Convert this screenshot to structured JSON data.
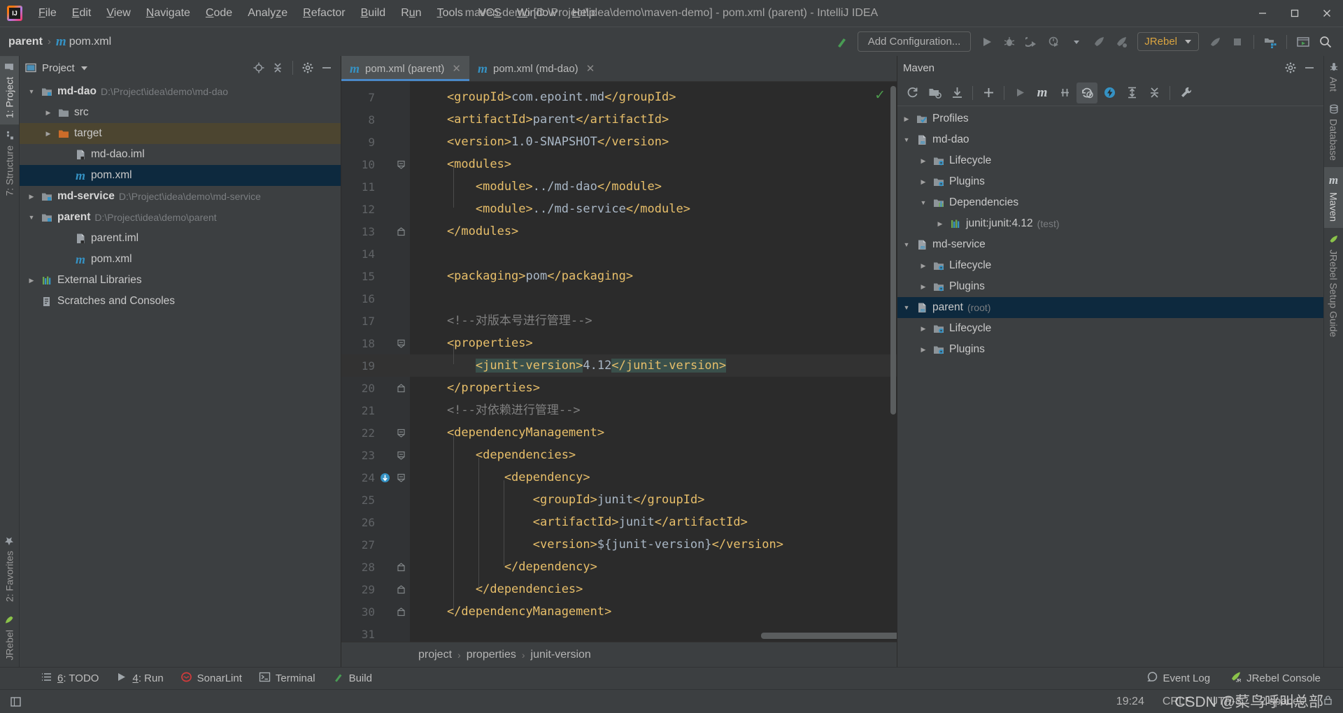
{
  "window": {
    "title": "maven-demo [D:\\Project\\idea\\demo\\maven-demo] - pom.xml (parent) - IntelliJ IDEA",
    "minimize": "─",
    "maximize": "☐",
    "close": "✕",
    "logo_text": "IJ"
  },
  "menubar": {
    "items": [
      {
        "label": "File",
        "mnemonic": "F"
      },
      {
        "label": "Edit",
        "mnemonic": "E"
      },
      {
        "label": "View",
        "mnemonic": "V"
      },
      {
        "label": "Navigate",
        "mnemonic": "N"
      },
      {
        "label": "Code",
        "mnemonic": "C"
      },
      {
        "label": "Analyze",
        "mnemonic": "z"
      },
      {
        "label": "Refactor",
        "mnemonic": "R"
      },
      {
        "label": "Build",
        "mnemonic": "B"
      },
      {
        "label": "Run",
        "mnemonic": "u"
      },
      {
        "label": "Tools",
        "mnemonic": "T"
      },
      {
        "label": "VCS",
        "mnemonic": "S"
      },
      {
        "label": "Window",
        "mnemonic": "W"
      },
      {
        "label": "Help",
        "mnemonic": "H"
      }
    ]
  },
  "navbar": {
    "crumbs": [
      "parent",
      "pom.xml"
    ],
    "separator": "›"
  },
  "toolbar": {
    "add_configuration_label": "Add Configuration...",
    "jrebel_label": "JRebel",
    "icons": [
      "build-hammer-icon",
      "run-icon",
      "debug-icon",
      "run-with-coverage-icon",
      "profiler-icon",
      "chevron-down-icon",
      "jrebel-run-icon",
      "jrebel-debug-icon",
      "jrebel-stop-icon",
      "stop-icon",
      "project-structure-icon",
      "update-running-app-icon",
      "search-everywhere-icon"
    ]
  },
  "left_stripe": {
    "top": [
      {
        "label": "1: Project",
        "icon": "folder-icon",
        "active": true
      },
      {
        "label": "7: Structure",
        "icon": "structure-icon",
        "active": false
      }
    ],
    "bottom": [
      {
        "label": "2: Favorites",
        "icon": "star-icon",
        "active": false
      },
      {
        "label": "JRebel",
        "icon": "jrebel-rocket-icon",
        "active": false
      }
    ]
  },
  "right_stripe": {
    "top": [
      {
        "label": "Ant",
        "icon": "ant-icon",
        "active": false
      },
      {
        "label": "Database",
        "icon": "database-icon",
        "active": false
      },
      {
        "label": "Maven",
        "icon": "maven-m-icon",
        "active": true
      }
    ],
    "bottom": [
      {
        "label": "JRebel Setup Guide",
        "icon": "jrebel-rocket-icon",
        "active": false
      }
    ]
  },
  "project_panel": {
    "title": "Project",
    "header_icons": [
      "locate-icon",
      "collapse-all-icon",
      "gear-icon",
      "hide-icon"
    ],
    "tree": [
      {
        "depth": 0,
        "arrow": "down",
        "icon": "module-folder-icon",
        "label": "md-dao",
        "bold": true,
        "path": "D:\\Project\\idea\\demo\\md-dao",
        "state": "normal"
      },
      {
        "depth": 1,
        "arrow": "right",
        "icon": "folder-icon",
        "label": "src",
        "bold": false,
        "path": "",
        "state": "normal"
      },
      {
        "depth": 1,
        "arrow": "right",
        "icon": "folder-orange-icon",
        "label": "target",
        "bold": false,
        "path": "",
        "state": "highlight"
      },
      {
        "depth": 2,
        "arrow": "none",
        "icon": "iml-file-icon",
        "label": "md-dao.iml",
        "bold": false,
        "path": "",
        "state": "normal"
      },
      {
        "depth": 2,
        "arrow": "none",
        "icon": "maven-m-icon",
        "label": "pom.xml",
        "bold": false,
        "path": "",
        "state": "selected"
      },
      {
        "depth": 0,
        "arrow": "right",
        "icon": "module-folder-icon",
        "label": "md-service",
        "bold": true,
        "path": "D:\\Project\\idea\\demo\\md-service",
        "state": "normal"
      },
      {
        "depth": 0,
        "arrow": "down",
        "icon": "module-folder-icon",
        "label": "parent",
        "bold": true,
        "path": "D:\\Project\\idea\\demo\\parent",
        "state": "normal"
      },
      {
        "depth": 2,
        "arrow": "none",
        "icon": "iml-file-icon",
        "label": "parent.iml",
        "bold": false,
        "path": "",
        "state": "normal"
      },
      {
        "depth": 2,
        "arrow": "none",
        "icon": "maven-m-icon",
        "label": "pom.xml",
        "bold": false,
        "path": "",
        "state": "normal"
      },
      {
        "depth": 0,
        "arrow": "right",
        "icon": "library-icon",
        "label": "External Libraries",
        "bold": false,
        "path": "",
        "state": "normal"
      },
      {
        "depth": 0,
        "arrow": "none",
        "icon": "scratches-icon",
        "label": "Scratches and Consoles",
        "bold": false,
        "path": "",
        "state": "normal"
      }
    ]
  },
  "editor": {
    "tabs": [
      {
        "label": "pom.xml (parent)",
        "icon": "maven-m-icon",
        "active": true
      },
      {
        "label": "pom.xml (md-dao)",
        "icon": "maven-m-icon",
        "active": false
      }
    ],
    "close_glyph": "✕",
    "inspection_ok_glyph": "✓",
    "first_line_number": 7,
    "lines": [
      {
        "n": 7,
        "fold": "none",
        "gutter_icon": "",
        "hl": false,
        "parts": [
          {
            "t": "tag",
            "s": "    <groupId>"
          },
          {
            "t": "txt",
            "s": "com.epoint.md"
          },
          {
            "t": "tag",
            "s": "</groupId>"
          }
        ]
      },
      {
        "n": 8,
        "fold": "none",
        "gutter_icon": "",
        "hl": false,
        "parts": [
          {
            "t": "tag",
            "s": "    <artifactId>"
          },
          {
            "t": "txt",
            "s": "parent"
          },
          {
            "t": "tag",
            "s": "</artifactId>"
          }
        ]
      },
      {
        "n": 9,
        "fold": "none",
        "gutter_icon": "",
        "hl": false,
        "parts": [
          {
            "t": "tag",
            "s": "    <version>"
          },
          {
            "t": "txt",
            "s": "1.0-SNAPSHOT"
          },
          {
            "t": "tag",
            "s": "</version>"
          }
        ]
      },
      {
        "n": 10,
        "fold": "open",
        "gutter_icon": "",
        "hl": false,
        "parts": [
          {
            "t": "tag",
            "s": "    <modules>"
          }
        ]
      },
      {
        "n": 11,
        "fold": "none",
        "gutter_icon": "",
        "hl": false,
        "parts": [
          {
            "t": "tag",
            "s": "        <module>"
          },
          {
            "t": "txt",
            "s": "../md-dao"
          },
          {
            "t": "tag",
            "s": "</module>"
          }
        ]
      },
      {
        "n": 12,
        "fold": "none",
        "gutter_icon": "",
        "hl": false,
        "parts": [
          {
            "t": "tag",
            "s": "        <module>"
          },
          {
            "t": "txt",
            "s": "../md-service"
          },
          {
            "t": "tag",
            "s": "</module>"
          }
        ]
      },
      {
        "n": 13,
        "fold": "close",
        "gutter_icon": "",
        "hl": false,
        "parts": [
          {
            "t": "tag",
            "s": "    </modules>"
          }
        ]
      },
      {
        "n": 14,
        "fold": "none",
        "gutter_icon": "",
        "hl": false,
        "parts": []
      },
      {
        "n": 15,
        "fold": "none",
        "gutter_icon": "",
        "hl": false,
        "parts": [
          {
            "t": "tag",
            "s": "    <packaging>"
          },
          {
            "t": "txt",
            "s": "pom"
          },
          {
            "t": "tag",
            "s": "</packaging>"
          }
        ]
      },
      {
        "n": 16,
        "fold": "none",
        "gutter_icon": "",
        "hl": false,
        "parts": []
      },
      {
        "n": 17,
        "fold": "none",
        "gutter_icon": "",
        "hl": false,
        "parts": [
          {
            "t": "cmt",
            "s": "    <!--对版本号进行管理-->"
          }
        ]
      },
      {
        "n": 18,
        "fold": "open",
        "gutter_icon": "",
        "hl": false,
        "parts": [
          {
            "t": "tag",
            "s": "    <properties>"
          }
        ]
      },
      {
        "n": 19,
        "fold": "none",
        "gutter_icon": "",
        "hl": true,
        "parts": [
          {
            "t": "txt",
            "s": "        "
          },
          {
            "t": "tag hlident",
            "s": "<junit-version>"
          },
          {
            "t": "txt",
            "s": "4.12"
          },
          {
            "t": "tag hlident",
            "s": "</junit-version>"
          }
        ]
      },
      {
        "n": 20,
        "fold": "close",
        "gutter_icon": "",
        "hl": false,
        "parts": [
          {
            "t": "tag",
            "s": "    </properties>"
          }
        ]
      },
      {
        "n": 21,
        "fold": "none",
        "gutter_icon": "",
        "hl": false,
        "parts": [
          {
            "t": "cmt",
            "s": "    <!--对依赖进行管理-->"
          }
        ]
      },
      {
        "n": 22,
        "fold": "open",
        "gutter_icon": "",
        "hl": false,
        "parts": [
          {
            "t": "tag",
            "s": "    <dependencyManagement>"
          }
        ]
      },
      {
        "n": 23,
        "fold": "open",
        "gutter_icon": "",
        "hl": false,
        "parts": [
          {
            "t": "tag",
            "s": "        <dependencies>"
          }
        ]
      },
      {
        "n": 24,
        "fold": "open",
        "gutter_icon": "download-dependency-icon",
        "hl": false,
        "parts": [
          {
            "t": "tag",
            "s": "            <dependency>"
          }
        ]
      },
      {
        "n": 25,
        "fold": "none",
        "gutter_icon": "",
        "hl": false,
        "parts": [
          {
            "t": "tag",
            "s": "                <groupId>"
          },
          {
            "t": "txt",
            "s": "junit"
          },
          {
            "t": "tag",
            "s": "</groupId>"
          }
        ]
      },
      {
        "n": 26,
        "fold": "none",
        "gutter_icon": "",
        "hl": false,
        "parts": [
          {
            "t": "tag",
            "s": "                <artifactId>"
          },
          {
            "t": "txt",
            "s": "junit"
          },
          {
            "t": "tag",
            "s": "</artifactId>"
          }
        ]
      },
      {
        "n": 27,
        "fold": "none",
        "gutter_icon": "",
        "hl": false,
        "parts": [
          {
            "t": "tag",
            "s": "                <version>"
          },
          {
            "t": "txt",
            "s": "${junit-version}"
          },
          {
            "t": "tag",
            "s": "</version>"
          }
        ]
      },
      {
        "n": 28,
        "fold": "close",
        "gutter_icon": "",
        "hl": false,
        "parts": [
          {
            "t": "tag",
            "s": "            </dependency>"
          }
        ]
      },
      {
        "n": 29,
        "fold": "close",
        "gutter_icon": "",
        "hl": false,
        "parts": [
          {
            "t": "tag",
            "s": "        </dependencies>"
          }
        ]
      },
      {
        "n": 30,
        "fold": "close",
        "gutter_icon": "",
        "hl": false,
        "parts": [
          {
            "t": "tag",
            "s": "    </dependencyManagement>"
          }
        ]
      },
      {
        "n": 31,
        "fold": "none",
        "gutter_icon": "",
        "hl": false,
        "parts": []
      }
    ],
    "breadcrumb": [
      "project",
      "properties",
      "junit-version"
    ],
    "breadcrumb_separator": "›"
  },
  "maven_panel": {
    "title": "Maven",
    "header_icons": [
      "gear-icon",
      "hide-icon"
    ],
    "toolbar_icons": [
      "reimport-icon",
      "generate-sources-icon",
      "download-sources-icon",
      "add-maven-project-icon",
      "run-icon",
      "execute-maven-goal-icon",
      "toggle-skip-tests-icon",
      "toggle-offline-icon",
      "toggle-auto-import-icon",
      "expand-all-icon",
      "collapse-all-icon",
      "maven-settings-icon"
    ],
    "tree": [
      {
        "depth": 0,
        "arrow": "right",
        "icon": "profiles-icon",
        "label": "Profiles",
        "suffix": "",
        "state": "normal"
      },
      {
        "depth": 0,
        "arrow": "down",
        "icon": "maven-proj-icon",
        "label": "md-dao",
        "suffix": "",
        "state": "normal"
      },
      {
        "depth": 1,
        "arrow": "right",
        "icon": "phase-icon",
        "label": "Lifecycle",
        "suffix": "",
        "state": "normal"
      },
      {
        "depth": 1,
        "arrow": "right",
        "icon": "phase-icon",
        "label": "Plugins",
        "suffix": "",
        "state": "normal"
      },
      {
        "depth": 1,
        "arrow": "down",
        "icon": "deps-icon",
        "label": "Dependencies",
        "suffix": "",
        "state": "normal"
      },
      {
        "depth": 2,
        "arrow": "right",
        "icon": "library-icon",
        "label": "junit:junit:4.12",
        "suffix": "(test)",
        "state": "normal"
      },
      {
        "depth": 0,
        "arrow": "down",
        "icon": "maven-proj-icon",
        "label": "md-service",
        "suffix": "",
        "state": "normal"
      },
      {
        "depth": 1,
        "arrow": "right",
        "icon": "phase-icon",
        "label": "Lifecycle",
        "suffix": "",
        "state": "normal"
      },
      {
        "depth": 1,
        "arrow": "right",
        "icon": "phase-icon",
        "label": "Plugins",
        "suffix": "",
        "state": "normal"
      },
      {
        "depth": 0,
        "arrow": "down",
        "icon": "maven-proj-icon",
        "label": "parent",
        "suffix": "(root)",
        "state": "selected"
      },
      {
        "depth": 1,
        "arrow": "right",
        "icon": "phase-icon",
        "label": "Lifecycle",
        "suffix": "",
        "state": "normal"
      },
      {
        "depth": 1,
        "arrow": "right",
        "icon": "phase-icon",
        "label": "Plugins",
        "suffix": "",
        "state": "normal"
      }
    ]
  },
  "bottom_bar": {
    "items": [
      {
        "label": "6: TODO",
        "mnemonic": "6",
        "icon": "todo-list-icon"
      },
      {
        "label": "4: Run",
        "mnemonic": "4",
        "icon": "run-icon"
      },
      {
        "label": "SonarLint",
        "mnemonic": "",
        "icon": "sonarlint-icon"
      },
      {
        "label": "Terminal",
        "mnemonic": "",
        "icon": "terminal-icon"
      },
      {
        "label": "Build",
        "mnemonic": "",
        "icon": "build-hammer-icon"
      }
    ],
    "right_items": [
      {
        "label": "Event Log",
        "icon": "event-log-icon"
      },
      {
        "label": "JRebel Console",
        "icon": "jrebel-rocket-icon"
      }
    ]
  },
  "statusbar": {
    "left_icon": "window-layout-icon",
    "items": [
      "19:24",
      "CRLF",
      "UTF-8",
      "2 spaces"
    ],
    "lock_icon": "lock-icon"
  },
  "watermark": "CSDN @菜鸟呼叫总部",
  "colors": {
    "accent_blue": "#4a88c7",
    "selection_blue": "#0d293e",
    "highlight_brown": "#4c4530",
    "tag_orange": "#e8bf6a",
    "text_blue_gray": "#a9b7c6",
    "comment_gray": "#808080",
    "ident_highlight": "#3a504b",
    "jrebel_gold": "#d9a441",
    "panel_bg": "#3c3f41",
    "editor_bg": "#2b2b2b",
    "gutter_bg": "#313335"
  }
}
